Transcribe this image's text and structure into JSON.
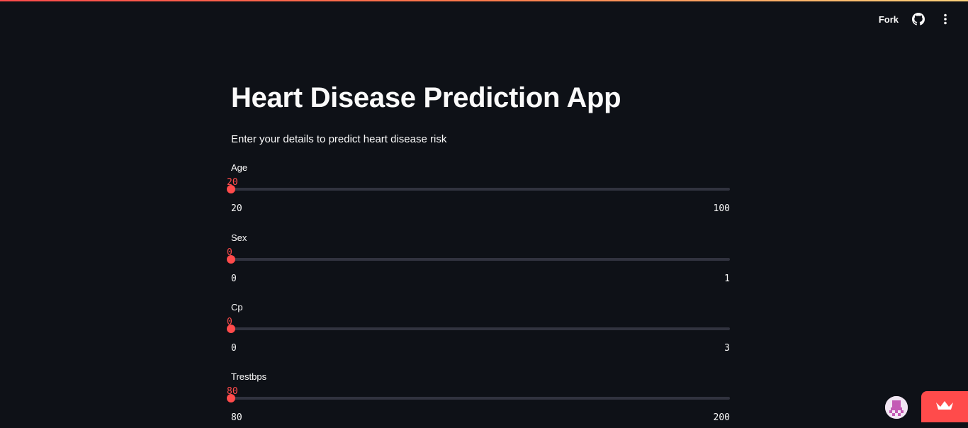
{
  "header": {
    "fork_label": "Fork",
    "icons": [
      "github-icon",
      "more-vertical-icon"
    ]
  },
  "main": {
    "title": "Heart Disease Prediction App",
    "subtitle": "Enter your details to predict heart disease risk",
    "sliders": [
      {
        "label": "Age",
        "value": "20",
        "min": "20",
        "max": "100"
      },
      {
        "label": "Sex",
        "value": "0",
        "min": "0",
        "max": "1"
      },
      {
        "label": "Cp",
        "value": "0",
        "min": "0",
        "max": "3"
      },
      {
        "label": "Trestbps",
        "value": "80",
        "min": "80",
        "max": "200"
      }
    ]
  },
  "colors": {
    "background": "#0e1117",
    "accent": "#ff4b4b",
    "track": "#31333f",
    "text": "#fafafa"
  },
  "footer": {
    "icons": [
      "user-avatar-icon",
      "streamlit-crown-icon"
    ]
  }
}
